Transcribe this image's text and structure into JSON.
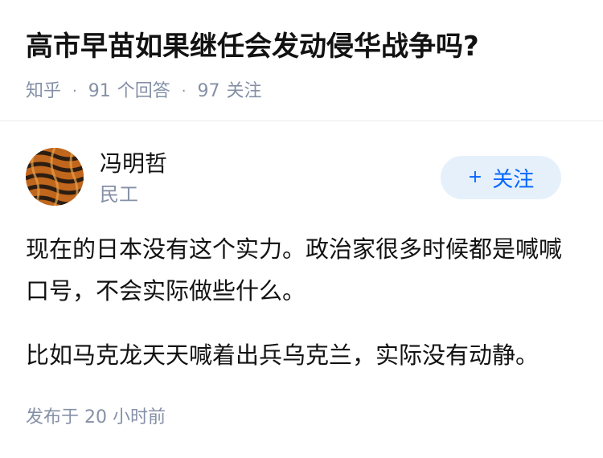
{
  "question": {
    "title": "高市早苗如果继任会发动侵华战争吗?",
    "source": "知乎",
    "answer_count": "91",
    "answer_label": "个回答",
    "follower_count": "97",
    "follower_label": "关注"
  },
  "author": {
    "name": "冯明哲",
    "headline": "民工",
    "avatar_icon": "avatar-image"
  },
  "follow_button": {
    "icon": "plus-icon",
    "plus": "+",
    "label": "关注"
  },
  "answer": {
    "paragraphs": [
      "现在的日本没有这个实力。政治家很多时候都是喊喊口号，不会实际做些什么。",
      "比如马克龙天天喊着出兵乌克兰，实际没有动静。"
    ],
    "time_prefix": "发布于",
    "time_value": "20 小时前"
  },
  "colors": {
    "text_primary": "#121212",
    "text_secondary": "#8590a6",
    "accent": "#0066ff",
    "button_bg": "#e5f0fb",
    "divider": "#ebebeb"
  }
}
